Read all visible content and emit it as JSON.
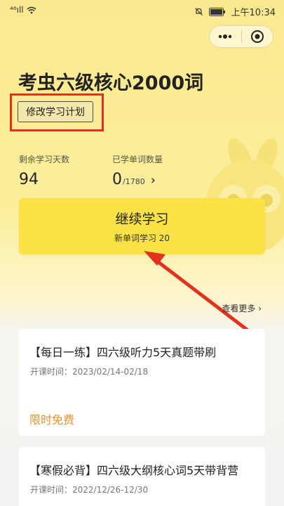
{
  "status_bar": {
    "signal": "⁴⁶ıll",
    "time": "上午10:34"
  },
  "capsule": {
    "menu_icon": "more-dots-icon",
    "close_icon": "target-circle-icon"
  },
  "header": {
    "title": "考虫六级核心2000词",
    "edit_plan_label": "修改学习计划"
  },
  "stats": {
    "remaining_days_label": "剩余学习天数",
    "remaining_days_value": "94",
    "learned_words_label": "已学单词数量",
    "learned_words_value": "0",
    "learned_words_total": "/1780",
    "chevron": "›"
  },
  "continue": {
    "label": "继续学习",
    "sub_label": "新单词学习 20"
  },
  "see_more": "查看更多 ›",
  "courses": [
    {
      "title": "【每日一练】四六级听力5天真题带刷",
      "date": "开课时间：2023/02/14-02/18",
      "price": "限时免费"
    },
    {
      "title": "【寒假必背】四六级大纲核心词5天带背营",
      "date": "开课时间：2022/12/26-12/30"
    }
  ],
  "colors": {
    "accent_yellow": "#fae247",
    "highlight_red": "#e0321d",
    "free_orange": "#e6912b"
  }
}
